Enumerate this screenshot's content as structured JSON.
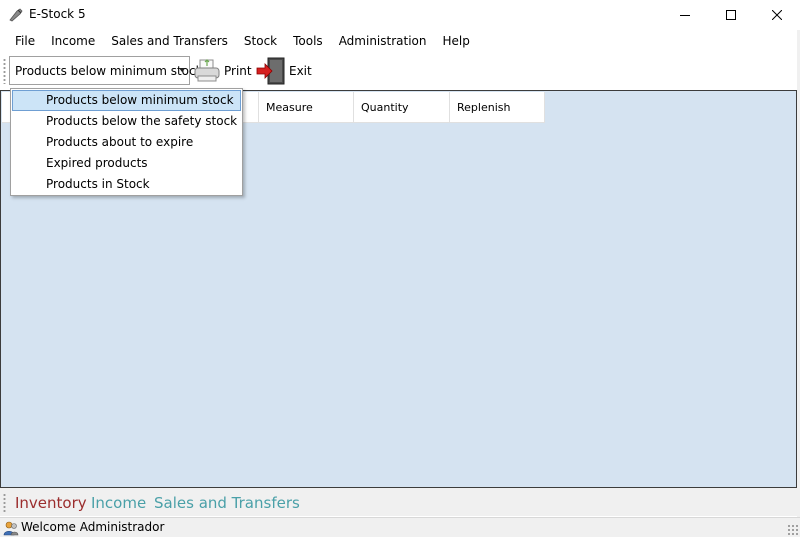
{
  "window": {
    "title": "E-Stock 5"
  },
  "menu": {
    "items": [
      "File",
      "Income",
      "Sales and Transfers",
      "Stock",
      "Tools",
      "Administration",
      "Help"
    ]
  },
  "toolbar": {
    "report_selected": "Products below minimum stock",
    "print_label": "Print",
    "exit_label": "Exit"
  },
  "dropdown": {
    "options": [
      "Products below minimum stock",
      "Products below the safety stock",
      "Products about to expire",
      "Expired products",
      "Products in Stock"
    ],
    "selected_index": 0
  },
  "grid": {
    "columns": [
      "Measure",
      "Quantity",
      "Replenish"
    ]
  },
  "tabs": {
    "items": [
      {
        "label": "Inventory",
        "color": "#9b2d2d",
        "active": true
      },
      {
        "label": "Income",
        "color": "#4aa0a8",
        "active": false
      },
      {
        "label": "Sales and Transfers",
        "color": "#4aa0a8",
        "active": false
      }
    ]
  },
  "status": {
    "text": "Welcome Administrador"
  },
  "colors": {
    "workspace_bg": "#d5e3f1",
    "selection_bg": "#cce4f7",
    "selection_border": "#6f9fd3"
  },
  "icons": {
    "app": "app-logo-icon",
    "print": "printer-icon",
    "exit": "exit-door-icon",
    "status": "users-icon"
  }
}
